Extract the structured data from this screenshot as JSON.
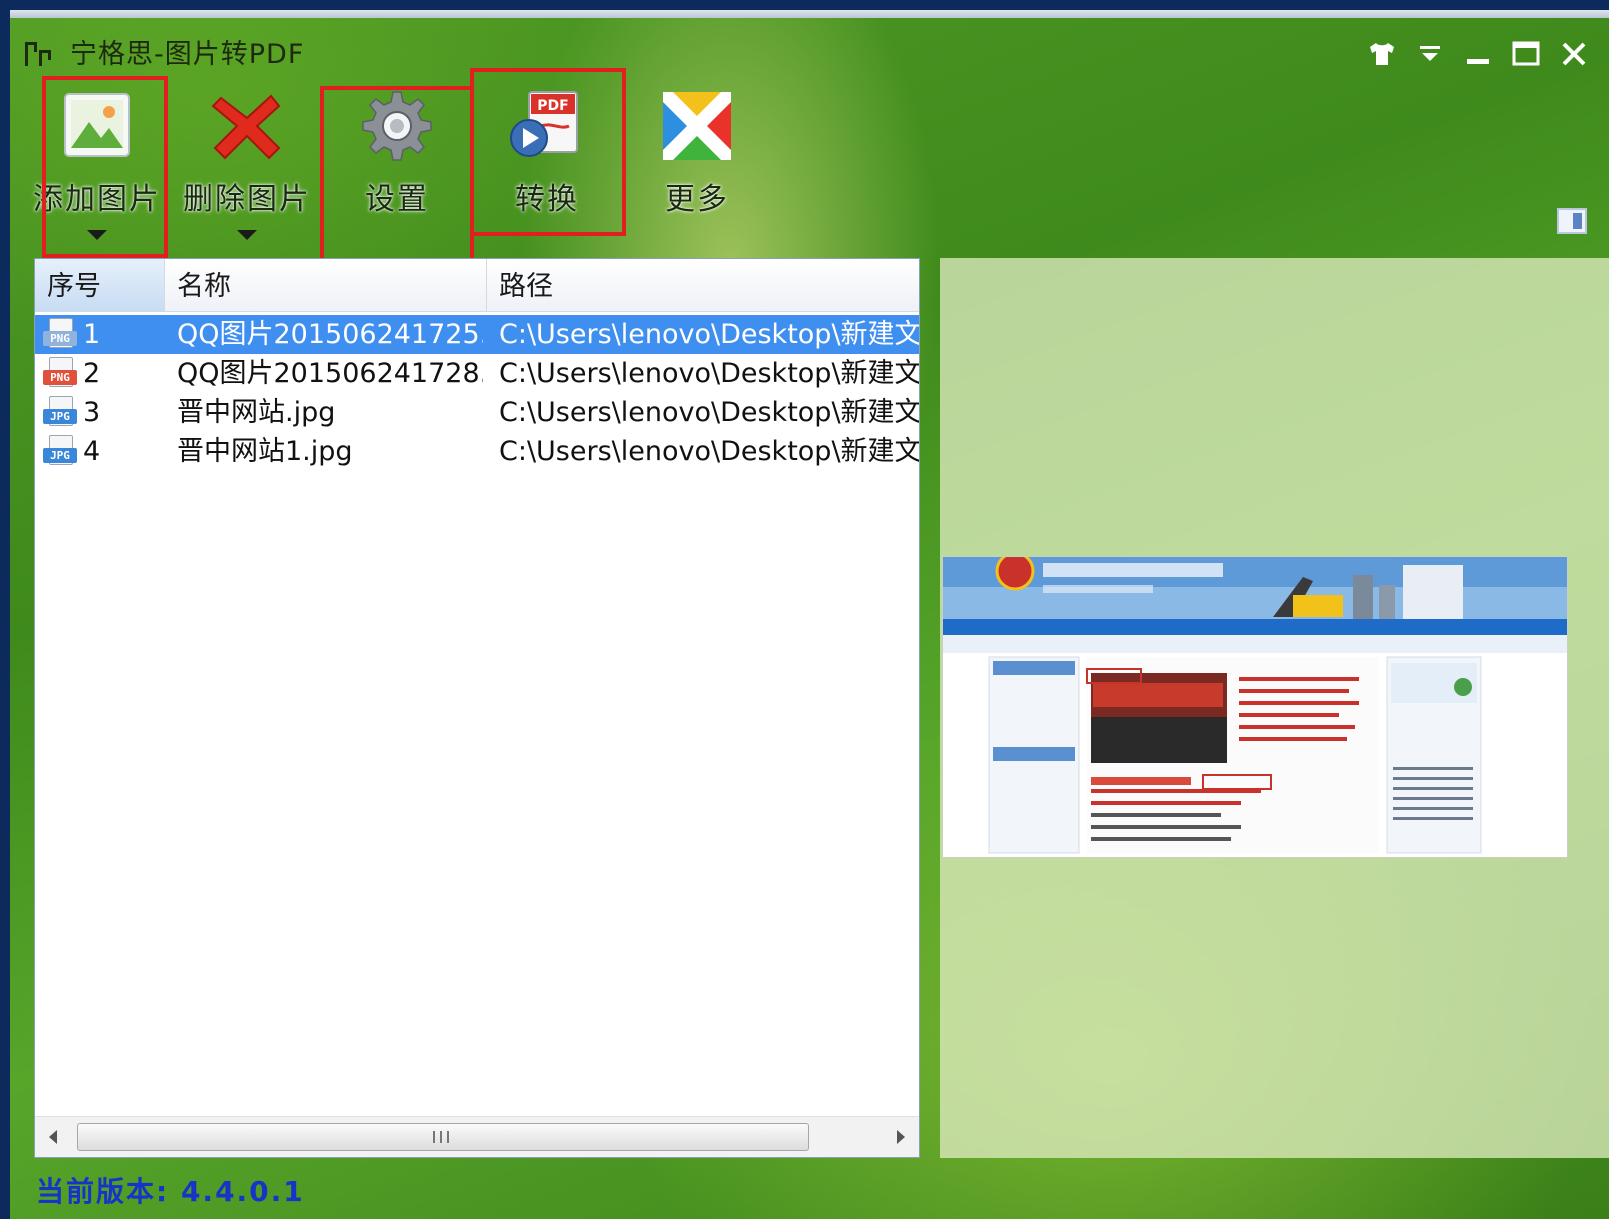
{
  "window": {
    "title": "宁格思-图片转PDF"
  },
  "toolbar": {
    "add_label": "添加图片",
    "delete_label": "删除图片",
    "settings_label": "设置",
    "convert_label": "转换",
    "more_label": "更多"
  },
  "table": {
    "columns": [
      "序号",
      "名称",
      "路径"
    ],
    "rows": [
      {
        "index": "1",
        "type": "PNG",
        "name": "QQ图片201506241725...",
        "path": "C:\\Users\\lenovo\\Desktop\\新建文件夹",
        "selected": true
      },
      {
        "index": "2",
        "type": "PNG",
        "name": "QQ图片201506241728...",
        "path": "C:\\Users\\lenovo\\Desktop\\新建文件夹",
        "selected": false
      },
      {
        "index": "3",
        "type": "JPG",
        "name": "晋中网站.jpg",
        "path": "C:\\Users\\lenovo\\Desktop\\新建文件夹",
        "selected": false
      },
      {
        "index": "4",
        "type": "JPG",
        "name": "晋中网站1.jpg",
        "path": "C:\\Users\\lenovo\\Desktop\\新建文件夹",
        "selected": false
      }
    ]
  },
  "scrollbar": {
    "grip": "III"
  },
  "status": {
    "version": "当前版本: 4.4.0.1"
  },
  "icons": {
    "app": "image-app-icon",
    "skin": "tshirt-icon",
    "menu": "dropdown-menu-icon",
    "minimize": "minimize-icon",
    "maximize": "maximize-icon",
    "close": "close-icon",
    "panel": "panel-toggle-icon"
  },
  "colors": {
    "highlight": "#e11f1f",
    "selection": "#3f8ff0",
    "version_text": "#1733c8"
  }
}
